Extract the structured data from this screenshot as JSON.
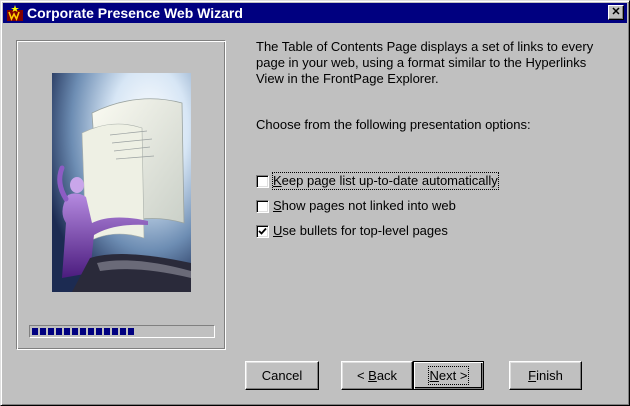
{
  "window": {
    "title": "Corporate Presence Web Wizard",
    "close_glyph": "✕"
  },
  "progress": {
    "fraction": 0.57
  },
  "description": "The Table of Contents Page displays a set of links to every page in your web, using a format similar to the Hyperlinks View in the FrontPage Explorer.",
  "prompt": "Choose from the following presentation options:",
  "options": [
    {
      "label": "Keep page list up-to-date automatically",
      "access_key": "K",
      "checked": false,
      "focused": true
    },
    {
      "label": "Show pages not linked into web",
      "access_key": "S",
      "checked": false,
      "focused": false
    },
    {
      "label": "Use bullets for top-level pages",
      "access_key": "U",
      "checked": true,
      "focused": false
    }
  ],
  "buttons": {
    "cancel": {
      "label": "Cancel"
    },
    "back": {
      "arrow": "<",
      "label": "Back",
      "access_key": "B"
    },
    "next": {
      "label": "Next",
      "arrow": ">",
      "access_key": "N"
    },
    "finish": {
      "label": "Finish",
      "access_key": "F"
    }
  },
  "colors": {
    "titlebar": "#000080",
    "face": "#c0c0c0",
    "progress_fill": "#000080",
    "illustration_accent": "#7a3fb0"
  }
}
